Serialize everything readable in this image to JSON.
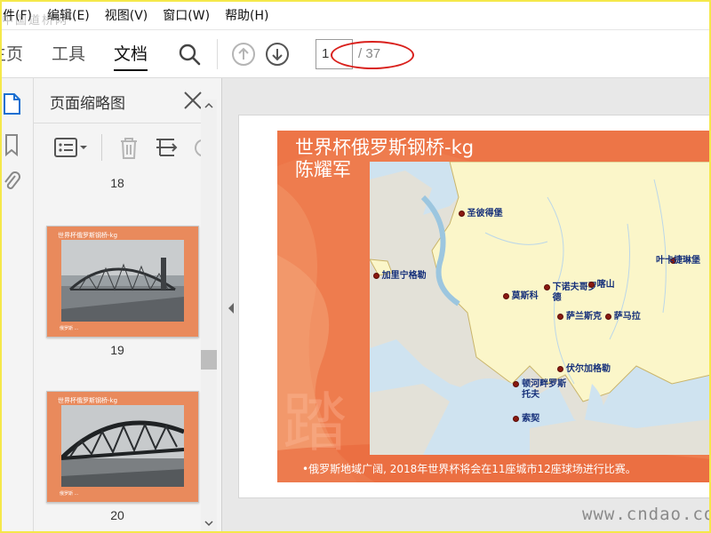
{
  "menu": {
    "items": [
      "件(F)",
      "编辑(E)",
      "视图(V)",
      "窗口(W)",
      "帮助(H)"
    ]
  },
  "watermark_top": "中国道桥网",
  "toolbar": {
    "tabs": [
      {
        "label": "主页",
        "active": false
      },
      {
        "label": "工具",
        "active": false
      },
      {
        "label": "文档",
        "active": true
      }
    ],
    "search_icon": "search-icon",
    "prev_page_icon": "arrow-up-circle-icon",
    "next_page_icon": "arrow-down-circle-icon",
    "current_page": "1",
    "total_pages": "/ 37"
  },
  "panel": {
    "title": "页面缩略图",
    "thumbnails": [
      {
        "page": "18"
      },
      {
        "page": "19",
        "title": "世界杯俄罗斯钢桥-kg",
        "footer": "俄罗斯 ..."
      },
      {
        "page": "20",
        "title": "世界杯俄罗斯钢桥-kg",
        "footer": "俄罗斯 ..."
      }
    ]
  },
  "slide": {
    "title_line1": "世界杯俄罗斯钢桥-kg",
    "title_line2": "陈耀军",
    "footer": "•俄罗斯地域广阔, 2018年世界杯将会在11座城市12座球场进行比赛。",
    "cities": [
      {
        "name": "圣彼得堡",
        "lx": 0.27,
        "ly": 0.18
      },
      {
        "name": "加里宁格勒",
        "lx": 0.03,
        "ly": 0.39
      },
      {
        "name": "叶卡捷琳堡",
        "lx": 0.89,
        "ly": 0.34
      },
      {
        "name": "莫斯科",
        "lx": 0.41,
        "ly": 0.46
      },
      {
        "name": "下诺夫哥罗\n德",
        "lx": 0.53,
        "ly": 0.43
      },
      {
        "name": "喀山",
        "lx": 0.65,
        "ly": 0.42
      },
      {
        "name": "萨兰斯克",
        "lx": 0.57,
        "ly": 0.53
      },
      {
        "name": "萨马拉",
        "lx": 0.71,
        "ly": 0.53
      },
      {
        "name": "伏尔加格勒",
        "lx": 0.57,
        "ly": 0.71
      },
      {
        "name": "顿河畔罗斯\n托夫",
        "lx": 0.43,
        "ly": 0.76
      },
      {
        "name": "索契",
        "lx": 0.43,
        "ly": 0.88
      }
    ]
  },
  "watermark_bottom": "www.cndao.com",
  "annotation_color": "#d9201c",
  "slide_color": "#ef7a4c"
}
